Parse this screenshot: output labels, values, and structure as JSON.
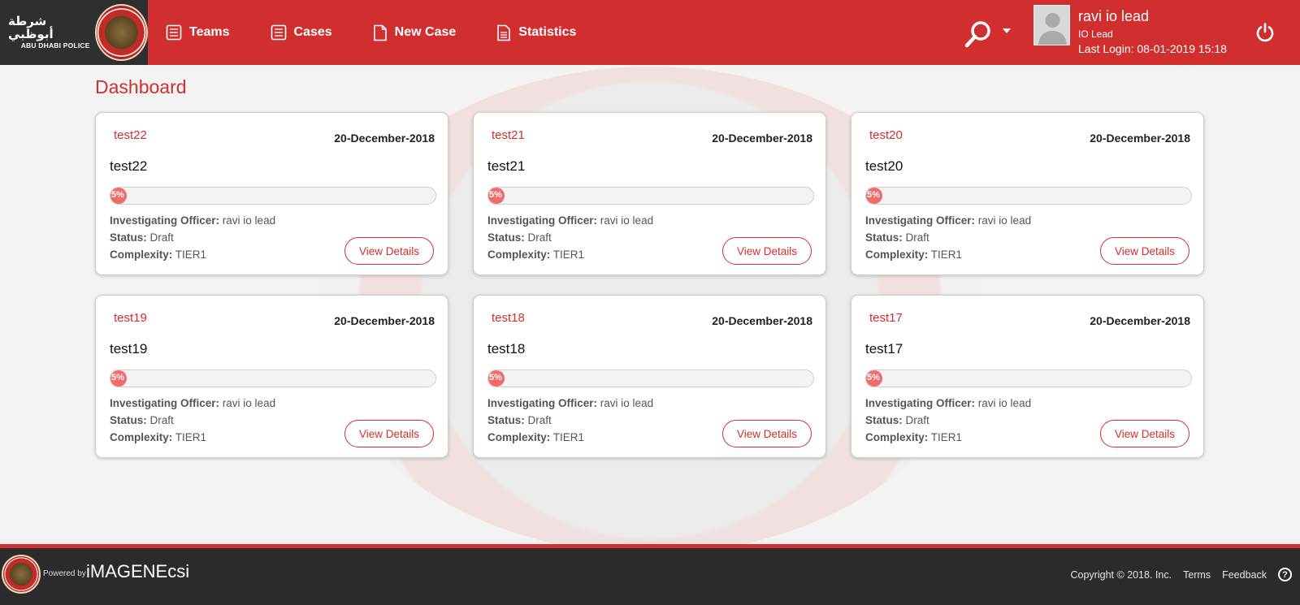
{
  "header": {
    "logo_arabic": "شرطة أبوظبي",
    "logo_english": "ABU DHABI POLICE",
    "nav": [
      {
        "label": "Teams",
        "icon": "list-document-icon"
      },
      {
        "label": "Cases",
        "icon": "list-document-icon"
      },
      {
        "label": "New Case",
        "icon": "document-icon"
      },
      {
        "label": "Statistics",
        "icon": "document-lines-icon"
      }
    ],
    "user": {
      "name": "ravi io lead",
      "role": "IO Lead",
      "last_login": "Last Login: 08-01-2019 15:18"
    }
  },
  "page": {
    "title": "Dashboard"
  },
  "labels": {
    "officer": "Investigating Officer:",
    "status": "Status:",
    "complexity": "Complexity:",
    "view_details": "View Details"
  },
  "cases": [
    {
      "code": "test22",
      "date": "20-December-2018",
      "title": "test22",
      "progress_label": "5%",
      "progress": 0.05,
      "officer": "ravi io lead",
      "status": "Draft",
      "complexity": "TIER1"
    },
    {
      "code": "test21",
      "date": "20-December-2018",
      "title": "test21",
      "progress_label": "5%",
      "progress": 0.05,
      "officer": "ravi io lead",
      "status": "Draft",
      "complexity": "TIER1"
    },
    {
      "code": "test20",
      "date": "20-December-2018",
      "title": "test20",
      "progress_label": "5%",
      "progress": 0.05,
      "officer": "ravi io lead",
      "status": "Draft",
      "complexity": "TIER1"
    },
    {
      "code": "test19",
      "date": "20-December-2018",
      "title": "test19",
      "progress_label": "5%",
      "progress": 0.05,
      "officer": "ravi io lead",
      "status": "Draft",
      "complexity": "TIER1"
    },
    {
      "code": "test18",
      "date": "20-December-2018",
      "title": "test18",
      "progress_label": "5%",
      "progress": 0.05,
      "officer": "ravi io lead",
      "status": "Draft",
      "complexity": "TIER1"
    },
    {
      "code": "test17",
      "date": "20-December-2018",
      "title": "test17",
      "progress_label": "5%",
      "progress": 0.05,
      "officer": "ravi io lead",
      "status": "Draft",
      "complexity": "TIER1"
    }
  ],
  "footer": {
    "powered_by": "Powered by",
    "brand": "iMAGENEcsi",
    "copyright": "Copyright © 2018. Inc.",
    "terms": "Terms",
    "feedback": "Feedback",
    "help": "?"
  },
  "colors": {
    "brand_red": "#d12f2f",
    "progress_red": "#f36a6a",
    "dark": "#2b2b2b"
  }
}
